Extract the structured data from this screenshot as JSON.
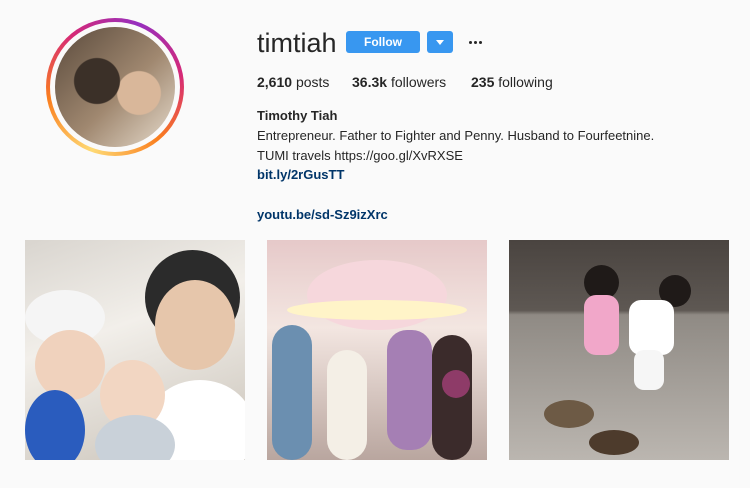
{
  "profile": {
    "username": "timtiah",
    "follow_label": "Follow",
    "stats": {
      "posts_count": "2,610",
      "posts_label": "posts",
      "followers_count": "36.3k",
      "followers_label": "followers",
      "following_count": "235",
      "following_label": "following"
    },
    "full_name": "Timothy Tiah",
    "bio_line1": "Entrepreneur. Father to Fighter and Penny. Husband to Fourfeetnine.",
    "bio_line2": "TUMI travels https://goo.gl/XvRXSE",
    "link1": "bit.ly/2rGusTT",
    "link2": "youtu.be/sd-Sz9izXrc"
  },
  "colors": {
    "accent": "#3897f0",
    "link": "#003569"
  },
  "icons": {
    "dropdown": "chevron-down-icon",
    "more": "more-options-icon"
  },
  "posts": [
    {
      "id": "post-1"
    },
    {
      "id": "post-2"
    },
    {
      "id": "post-3"
    }
  ]
}
